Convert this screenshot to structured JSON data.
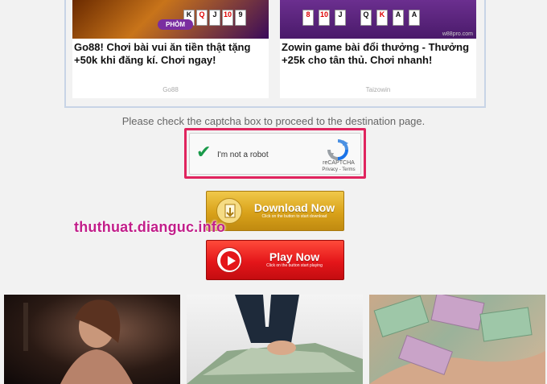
{
  "ads": [
    {
      "title": "Go88! Chơi bài vui ăn tiền thật tặng +50k khi đăng kí. Chơi ngay!",
      "source": "Go88",
      "badge": "PHỎM",
      "cards": [
        "K",
        "Q",
        "J",
        "10",
        "9"
      ]
    },
    {
      "title": "Zowin game bài đổi thưởng - Thưởng +25k cho tân thủ. Chơi nhanh!",
      "source": "Taizowin",
      "footer": "w88pro.com",
      "cards": [
        "8",
        "10",
        "J",
        "Q",
        "K",
        "A",
        "A"
      ]
    }
  ],
  "notice": "Please check the captcha box to proceed to the destination page.",
  "captcha": {
    "label": "I'm not a robot",
    "brand": "reCAPTCHA",
    "links": "Privacy - Terms",
    "checked": true
  },
  "buttons": {
    "download": {
      "title": "Download Now",
      "subtitle": "Click on the button to start download"
    },
    "play": {
      "title": "Play Now",
      "subtitle": "Click on the button start playing"
    }
  },
  "watermark": "thuthuat.dianguc.info",
  "colors": {
    "captcha_outline": "#e0245e",
    "download_gold": "#d9a21a",
    "play_red": "#e4161a",
    "watermark": "#c21e8a",
    "check_green": "#1a9a4a"
  }
}
